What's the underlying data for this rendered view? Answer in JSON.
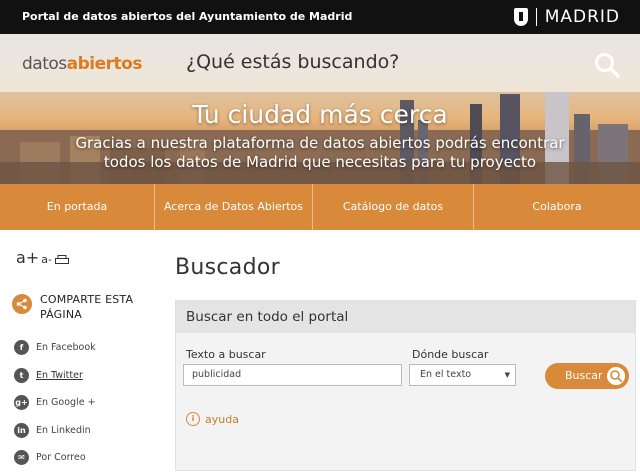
{
  "topbar": {
    "portal_title": "Portal de datos abiertos del Ayuntamiento de Madrid",
    "brand": "MADRID"
  },
  "hero": {
    "logo_part1": "datos",
    "logo_part2": "abiertos",
    "search_placeholder": "¿Qué estás buscando?",
    "title": "Tu ciudad más cerca",
    "subtitle_line1": "Gracias a nuestra plataforma de datos abiertos podrás encontrar",
    "subtitle_line2": "todos los datos de Madrid que necesitas para tu proyecto"
  },
  "nav": {
    "items": [
      "En portada",
      "Acerca de Datos Abiertos",
      "Catálogo de datos",
      "Colabora"
    ]
  },
  "sidebar": {
    "font_larger": "a+",
    "font_smaller": "a-",
    "share_line1": "COMPARTE ESTA",
    "share_line2": "PÁGINA",
    "social": [
      {
        "label": "En Facebook",
        "icon": "facebook-icon",
        "glyph": "f"
      },
      {
        "label": "En Twitter",
        "icon": "twitter-icon",
        "glyph": "t"
      },
      {
        "label": "En Google +",
        "icon": "google-plus-icon",
        "glyph": "g+"
      },
      {
        "label": "En Linkedin",
        "icon": "linkedin-icon",
        "glyph": "in"
      },
      {
        "label": "Por Correo",
        "icon": "mail-icon",
        "glyph": "✉"
      }
    ]
  },
  "main": {
    "page_title": "Buscador",
    "panel_title": "Buscar en todo el portal",
    "label_texto": "Texto a buscar",
    "input_value": "publicidad",
    "label_donde": "Dónde buscar",
    "select_value": "En el texto",
    "button_label": "Buscar",
    "help_label": "ayuda"
  },
  "colors": {
    "accent": "#d9893a",
    "topbar": "#111111",
    "logo_accent": "#e07a1f"
  }
}
